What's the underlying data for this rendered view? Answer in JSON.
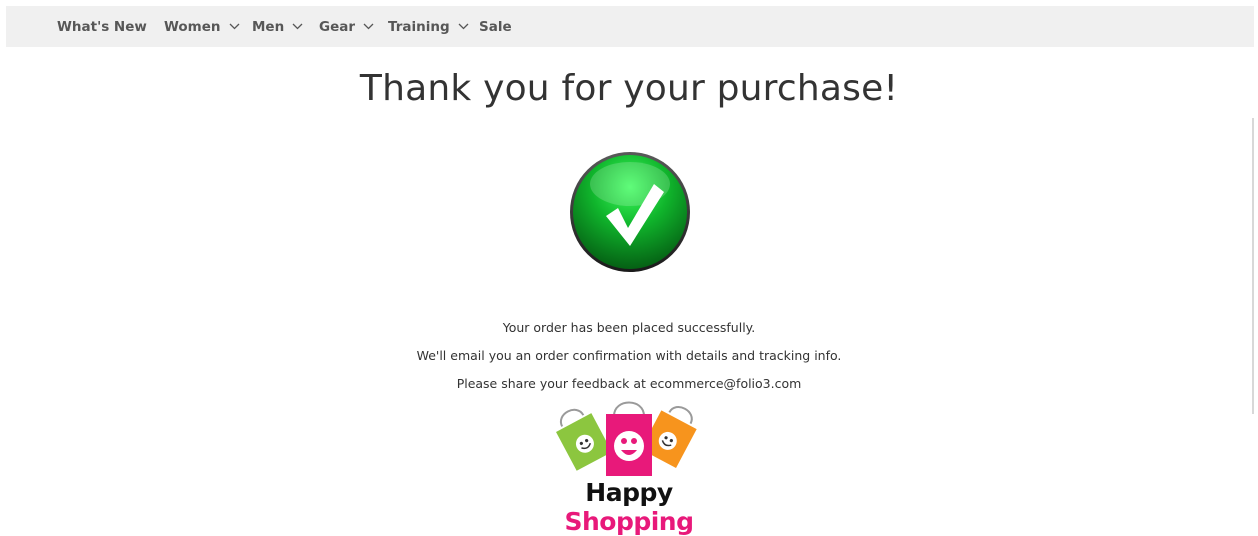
{
  "nav": {
    "items": [
      {
        "label": "What's New",
        "has_dropdown": false
      },
      {
        "label": "Women",
        "has_dropdown": true
      },
      {
        "label": "Men",
        "has_dropdown": true
      },
      {
        "label": "Gear",
        "has_dropdown": true
      },
      {
        "label": "Training",
        "has_dropdown": true
      },
      {
        "label": "Sale",
        "has_dropdown": false
      }
    ]
  },
  "main": {
    "title": "Thank you for your purchase!",
    "success_icon": "green-checkmark-circle-icon",
    "messages": [
      "Your order has been placed successfully.",
      "We'll email you an order confirmation with details and tracking info.",
      "Please share your feedback at ecommerce@folio3.com"
    ],
    "logo": {
      "text_part1": "Happy",
      "text_part2": "Shopping"
    }
  },
  "colors": {
    "navbar_bg": "#f0f0f0",
    "success_green": "#0fa82a",
    "brand_pink": "#e8197a",
    "bag_green": "#8cc63f",
    "bag_orange": "#f7941d"
  }
}
